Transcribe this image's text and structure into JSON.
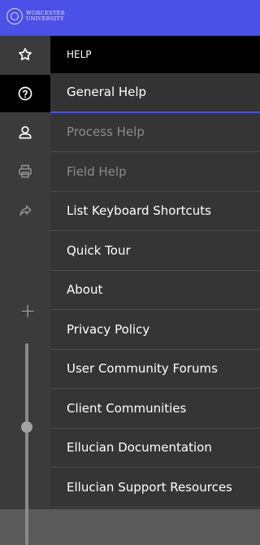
{
  "header": {
    "logo_line1": "WORCESTER",
    "logo_line2": "UNIVERSITY"
  },
  "rail": {
    "items": [
      {
        "icon": "star-icon"
      },
      {
        "icon": "help-icon"
      },
      {
        "icon": "user-icon"
      },
      {
        "icon": "print-icon"
      },
      {
        "icon": "share-icon"
      }
    ],
    "plus": "+"
  },
  "menu": {
    "title": "HELP",
    "items": [
      {
        "label": "General Help",
        "enabled": true
      },
      {
        "label": "Process Help",
        "enabled": false
      },
      {
        "label": "Field Help",
        "enabled": false
      },
      {
        "label": "List Keyboard Shortcuts",
        "enabled": true
      },
      {
        "label": "Quick Tour",
        "enabled": true
      },
      {
        "label": "About",
        "enabled": true
      },
      {
        "label": "Privacy Policy",
        "enabled": true
      },
      {
        "label": "User Community Forums",
        "enabled": true
      },
      {
        "label": "Client Communities",
        "enabled": true
      },
      {
        "label": "Ellucian Documentation",
        "enabled": true
      },
      {
        "label": "Ellucian Support Resources",
        "enabled": true
      }
    ]
  }
}
